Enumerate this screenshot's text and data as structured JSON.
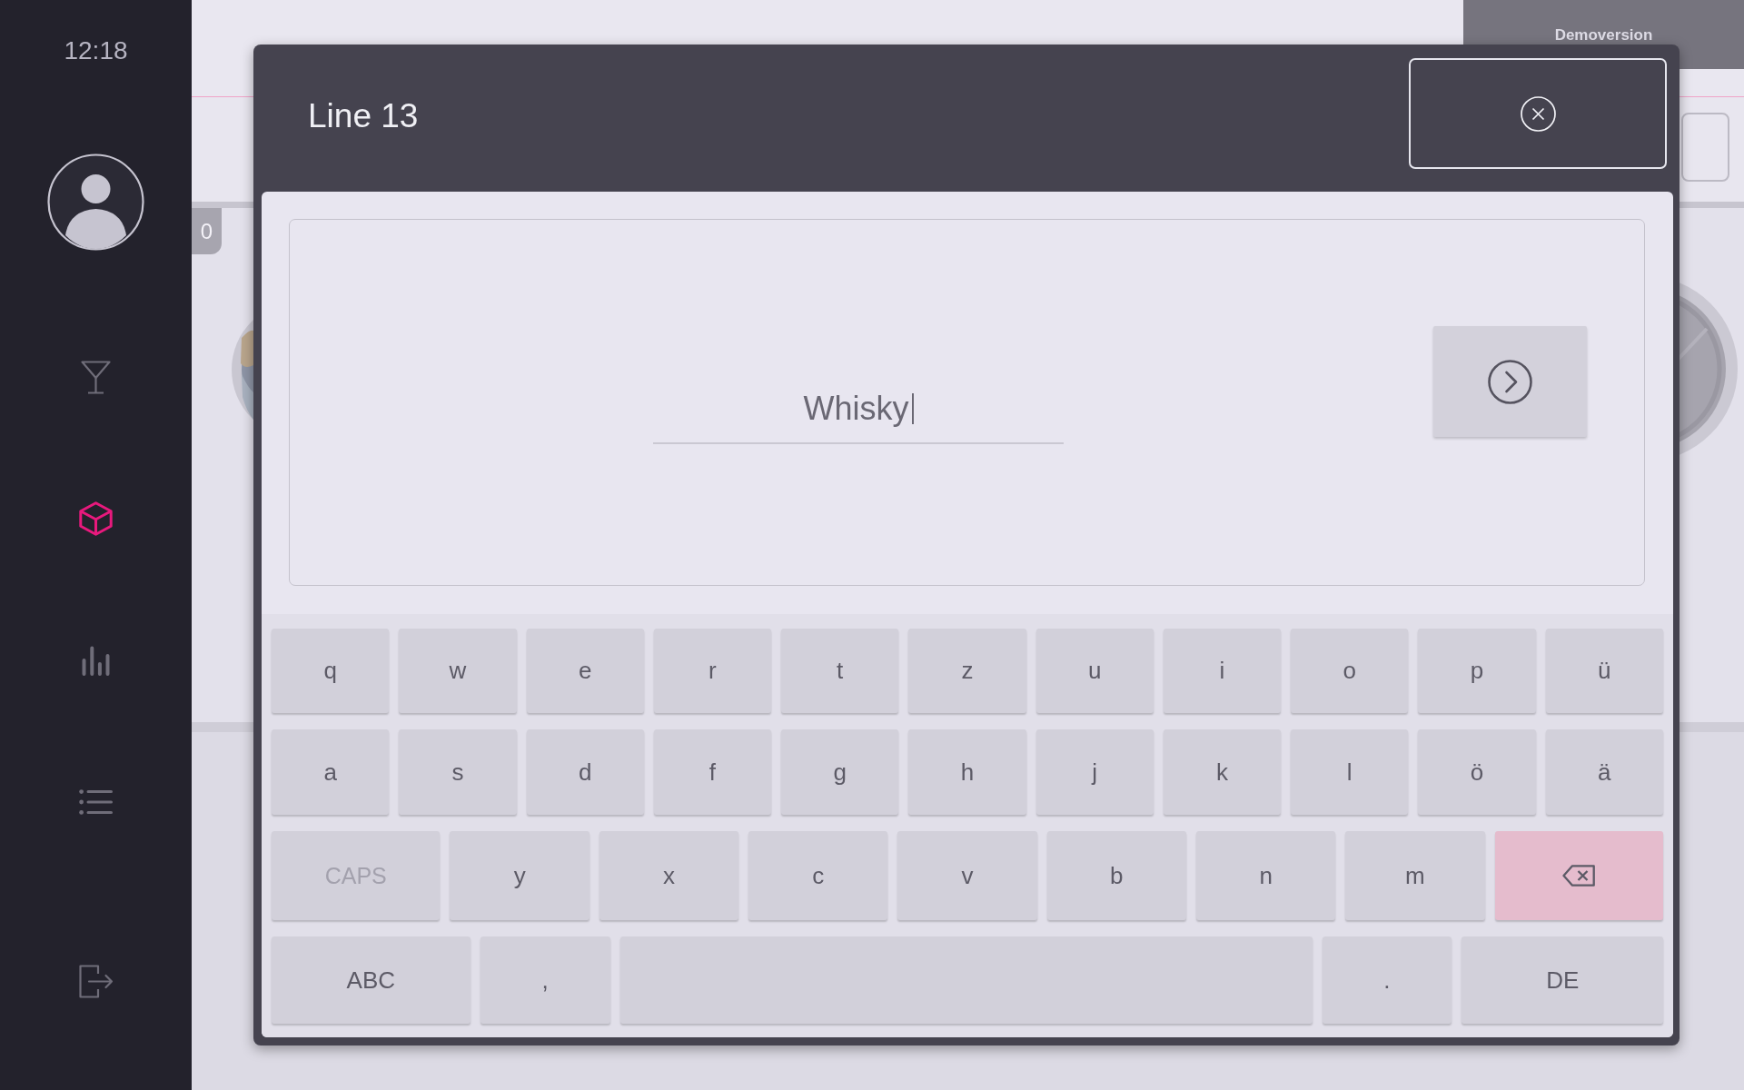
{
  "sidebar": {
    "time": "12:18",
    "items": [
      {
        "kind": "cocktail",
        "selected": false
      },
      {
        "kind": "cube",
        "selected": true
      },
      {
        "kind": "chart",
        "selected": false
      },
      {
        "kind": "list",
        "selected": false
      },
      {
        "kind": "logout",
        "selected": false
      }
    ]
  },
  "background": {
    "demo_label": "Demoversion",
    "badge": "0"
  },
  "dialog": {
    "title": "Line 13",
    "input": {
      "value": "Whisky"
    },
    "keyboard": {
      "rows": [
        {
          "keys": [
            {
              "kind": "char",
              "label": "q"
            },
            {
              "kind": "char",
              "label": "w"
            },
            {
              "kind": "char",
              "label": "e"
            },
            {
              "kind": "char",
              "label": "r"
            },
            {
              "kind": "char",
              "label": "t"
            },
            {
              "kind": "char",
              "label": "z"
            },
            {
              "kind": "char",
              "label": "u"
            },
            {
              "kind": "char",
              "label": "i"
            },
            {
              "kind": "char",
              "label": "o"
            },
            {
              "kind": "char",
              "label": "p"
            },
            {
              "kind": "char",
              "label": "ü"
            }
          ]
        },
        {
          "keys": [
            {
              "kind": "char",
              "label": "a"
            },
            {
              "kind": "char",
              "label": "s"
            },
            {
              "kind": "char",
              "label": "d"
            },
            {
              "kind": "char",
              "label": "f"
            },
            {
              "kind": "char",
              "label": "g"
            },
            {
              "kind": "char",
              "label": "h"
            },
            {
              "kind": "char",
              "label": "j"
            },
            {
              "kind": "char",
              "label": "k"
            },
            {
              "kind": "char",
              "label": "l"
            },
            {
              "kind": "char",
              "label": "ö"
            },
            {
              "kind": "char",
              "label": "ä"
            }
          ]
        },
        {
          "keys": [
            {
              "kind": "caps",
              "label": "CAPS",
              "on": false
            },
            {
              "kind": "char",
              "label": "y"
            },
            {
              "kind": "char",
              "label": "x"
            },
            {
              "kind": "char",
              "label": "c"
            },
            {
              "kind": "char",
              "label": "v"
            },
            {
              "kind": "char",
              "label": "b"
            },
            {
              "kind": "char",
              "label": "n"
            },
            {
              "kind": "char",
              "label": "m"
            },
            {
              "kind": "backspace"
            }
          ]
        },
        {
          "keys": [
            {
              "kind": "mode",
              "label": "ABC"
            },
            {
              "kind": "char",
              "label": ","
            },
            {
              "kind": "space"
            },
            {
              "kind": "char",
              "label": "."
            },
            {
              "kind": "language",
              "label": "DE"
            }
          ]
        }
      ]
    }
  }
}
